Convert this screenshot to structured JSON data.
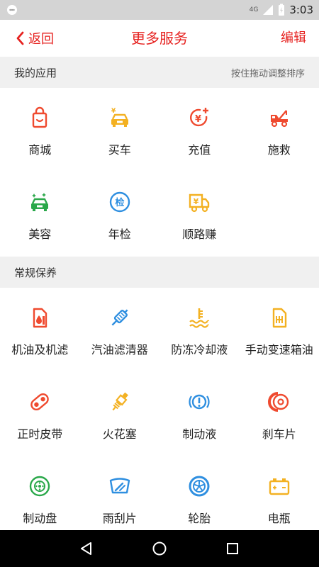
{
  "status_bar": {
    "network": "4G",
    "time": "3:03"
  },
  "header": {
    "back_label": "返回",
    "title": "更多服务",
    "edit_label": "编辑"
  },
  "my_apps": {
    "title": "我的应用",
    "hint": "按住拖动调整排序",
    "items": [
      {
        "label": "商城",
        "icon": "shopping-bag-icon",
        "color": "#ef4a2f"
      },
      {
        "label": "买车",
        "icon": "car-yen-icon",
        "color": "#f3b122"
      },
      {
        "label": "充值",
        "icon": "yen-plus-icon",
        "color": "#ef4a2f"
      },
      {
        "label": "施救",
        "icon": "tow-truck-icon",
        "color": "#ef4a2f"
      },
      {
        "label": "美容",
        "icon": "car-sparkle-icon",
        "color": "#2aa84a"
      },
      {
        "label": "年检",
        "icon": "inspection-icon",
        "color": "#2f8fe0"
      },
      {
        "label": "顺路赚",
        "icon": "delivery-truck-icon",
        "color": "#f3b122"
      }
    ]
  },
  "maintenance": {
    "title": "常规保养",
    "items": [
      {
        "label": "机油及机滤",
        "icon": "oil-can-icon",
        "color": "#ef4a2f"
      },
      {
        "label": "汽油滤清器",
        "icon": "fuel-filter-icon",
        "color": "#2f8fe0"
      },
      {
        "label": "防冻冷却液",
        "icon": "coolant-icon",
        "color": "#f3b122"
      },
      {
        "label": "手动变速箱油",
        "icon": "gearbox-oil-icon",
        "color": "#f3b122"
      },
      {
        "label": "正时皮带",
        "icon": "timing-belt-icon",
        "color": "#ef4a2f"
      },
      {
        "label": "火花塞",
        "icon": "spark-plug-icon",
        "color": "#f3b122"
      },
      {
        "label": "制动液",
        "icon": "brake-fluid-icon",
        "color": "#2f8fe0"
      },
      {
        "label": "刹车片",
        "icon": "brake-pad-icon",
        "color": "#ef4a2f"
      },
      {
        "label": "制动盘",
        "icon": "brake-disc-icon",
        "color": "#2aa84a"
      },
      {
        "label": "雨刮片",
        "icon": "wiper-icon",
        "color": "#2f8fe0"
      },
      {
        "label": "轮胎",
        "icon": "tire-icon",
        "color": "#2f8fe0"
      },
      {
        "label": "电瓶",
        "icon": "battery-icon",
        "color": "#f3b122"
      }
    ]
  },
  "colors": {
    "accent": "#e6211f",
    "section_bg": "#f0f0f0"
  }
}
